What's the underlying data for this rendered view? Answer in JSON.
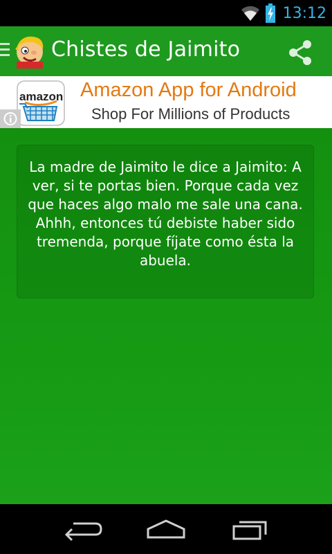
{
  "status_bar": {
    "time": "13:12",
    "icons": [
      "wifi-icon",
      "battery-charging-icon"
    ],
    "accent_color": "#33b5e5"
  },
  "action_bar": {
    "title": "Chistes de Jaimito",
    "background": "#1e9a1e",
    "icons": [
      "drawer-menu-icon",
      "app-logo",
      "share-icon"
    ]
  },
  "ad_banner": {
    "brand": "amazon",
    "title": "Amazon App for Android",
    "subtitle": "Shop For Millions of Products",
    "title_color": "#e47911"
  },
  "joke": {
    "text": "La madre de Jaimito le dice a Jaimito: A ver, si te portas bien. Porque cada vez que haces algo malo me sale una cana. Ahhh, entonces tú debiste haber sido tremenda, porque fíjate como ésta la abuela."
  },
  "nav_bar": {
    "icons": [
      "back-icon",
      "home-icon",
      "recents-icon"
    ]
  }
}
